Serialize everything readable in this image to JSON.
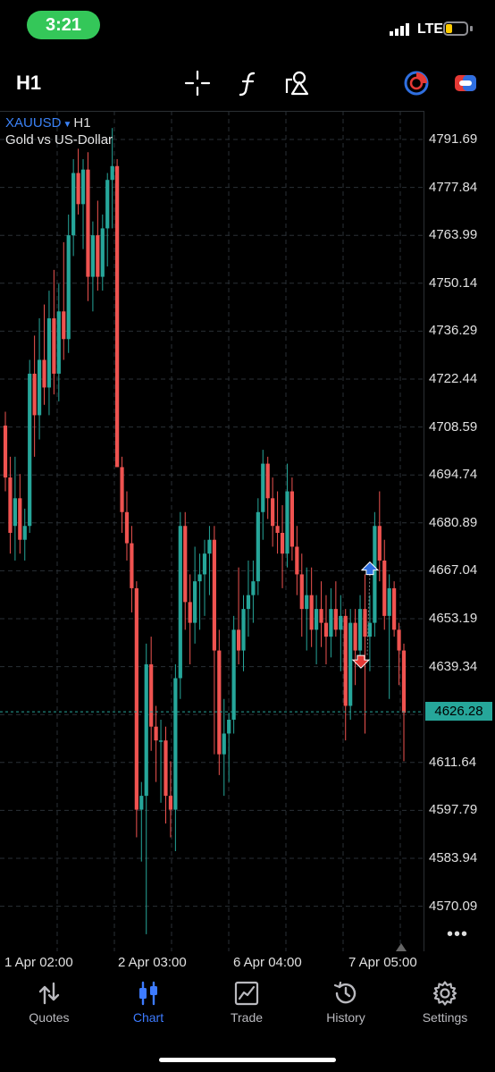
{
  "status_bar": {
    "time": "3:21",
    "network": "LTE",
    "battery_level": 0.3
  },
  "toolbar": {
    "timeframe": "H1",
    "icons": [
      "crosshair-icon",
      "function-icon",
      "objects-icon",
      "timeframe-clock-icon",
      "switch-icon"
    ]
  },
  "chart": {
    "symbol": "XAUUSD",
    "timeframe": "H1",
    "description": "Gold vs US-Dollar",
    "current_price": "4626.28",
    "colors": {
      "bull": "#26a69a",
      "bear": "#ef5350",
      "grid": "#2a3036",
      "price_line": "#26a69a"
    },
    "y_labels": [
      "4791.69",
      "4777.84",
      "4763.99",
      "4750.14",
      "4736.29",
      "4722.44",
      "4708.59",
      "4694.74",
      "4680.89",
      "4667.04",
      "4653.19",
      "4639.34",
      "4611.64",
      "4597.79",
      "4583.94",
      "4570.09"
    ],
    "x_labels": [
      "1 Apr 02:00",
      "2 Apr 03:00",
      "6 Apr 04:00",
      "7 Apr 05:00"
    ]
  },
  "chart_data": {
    "type": "candlestick",
    "ylim": [
      4562.0,
      4799.0
    ],
    "x_labels": [
      "1 Apr 02:00",
      "2 Apr 03:00",
      "6 Apr 04:00",
      "7 Apr 05:00"
    ],
    "candles": [
      [
        4709.0,
        4713.0,
        4690.0,
        4694.0
      ],
      [
        4694.0,
        4700.0,
        4672.0,
        4678.0
      ],
      [
        4680.0,
        4700.0,
        4670.0,
        4688.0
      ],
      [
        4688.0,
        4695.0,
        4672.0,
        4676.0
      ],
      [
        4676.0,
        4685.0,
        4670.0,
        4680.0
      ],
      [
        4680.0,
        4728.0,
        4678.0,
        4724.0
      ],
      [
        4724.0,
        4735.0,
        4700.0,
        4712.0
      ],
      [
        4712.0,
        4740.0,
        4705.0,
        4728.0
      ],
      [
        4728.0,
        4744.0,
        4715.0,
        4720.0
      ],
      [
        4720.0,
        4748.0,
        4712.0,
        4740.0
      ],
      [
        4740.0,
        4754.0,
        4718.0,
        4724.0
      ],
      [
        4724.0,
        4750.0,
        4716.0,
        4742.0
      ],
      [
        4742.0,
        4762.0,
        4728.0,
        4734.0
      ],
      [
        4734.0,
        4770.0,
        4730.0,
        4764.0
      ],
      [
        4764.0,
        4786.0,
        4758.0,
        4782.0
      ],
      [
        4782.0,
        4789.0,
        4770.0,
        4773.0
      ],
      [
        4773.0,
        4786.0,
        4760.0,
        4783.0
      ],
      [
        4783.0,
        4788.0,
        4745.0,
        4752.0
      ],
      [
        4752.0,
        4768.0,
        4742.0,
        4764.0
      ],
      [
        4764.0,
        4774.0,
        4748.0,
        4752.0
      ],
      [
        4752.0,
        4770.0,
        4748.0,
        4766.0
      ],
      [
        4766.0,
        4782.0,
        4755.0,
        4780.0
      ],
      [
        4780.0,
        4795.0,
        4766.0,
        4784.0
      ],
      [
        4784.0,
        4786.0,
        4697.0,
        4697.0
      ],
      [
        4697.0,
        4700.0,
        4678.0,
        4684.0
      ],
      [
        4684.0,
        4690.0,
        4670.0,
        4675.0
      ],
      [
        4675.0,
        4680.0,
        4655.0,
        4662.0
      ],
      [
        4662.0,
        4664.0,
        4590.0,
        4598.0
      ],
      [
        4598.0,
        4606.0,
        4583.0,
        4602.0
      ],
      [
        4602.0,
        4646.0,
        4562.0,
        4640.0
      ],
      [
        4640.0,
        4648.0,
        4615.0,
        4622.0
      ],
      [
        4622.0,
        4628.0,
        4606.0,
        4618.0
      ],
      [
        4618.0,
        4624.0,
        4600.0,
        4618.0
      ],
      [
        4618.0,
        4622.0,
        4594.0,
        4602.0
      ],
      [
        4602.0,
        4612.0,
        4590.0,
        4598.0
      ],
      [
        4598.0,
        4640.0,
        4586.0,
        4636.0
      ],
      [
        4636.0,
        4684.0,
        4630.0,
        4680.0
      ],
      [
        4680.0,
        4684.0,
        4650.0,
        4658.0
      ],
      [
        4658.0,
        4666.0,
        4640.0,
        4652.0
      ],
      [
        4652.0,
        4674.0,
        4646.0,
        4664.0
      ],
      [
        4664.0,
        4672.0,
        4650.0,
        4666.0
      ],
      [
        4666.0,
        4676.0,
        4654.0,
        4672.0
      ],
      [
        4672.0,
        4680.0,
        4660.0,
        4676.0
      ],
      [
        4676.0,
        4680.0,
        4614.0,
        4644.0
      ],
      [
        4644.0,
        4650.0,
        4608.0,
        4614.0
      ],
      [
        4614.0,
        4630.0,
        4602.0,
        4620.0
      ],
      [
        4620.0,
        4626.0,
        4606.0,
        4624.0
      ],
      [
        4624.0,
        4654.0,
        4620.0,
        4650.0
      ],
      [
        4650.0,
        4668.0,
        4640.0,
        4644.0
      ],
      [
        4644.0,
        4660.0,
        4638.0,
        4656.0
      ],
      [
        4656.0,
        4670.0,
        4648.0,
        4660.0
      ],
      [
        4660.0,
        4670.0,
        4652.0,
        4664.0
      ],
      [
        4664.0,
        4688.0,
        4660.0,
        4684.0
      ],
      [
        4684.0,
        4702.0,
        4676.0,
        4698.0
      ],
      [
        4698.0,
        4700.0,
        4682.0,
        4688.0
      ],
      [
        4688.0,
        4694.0,
        4674.0,
        4680.0
      ],
      [
        4680.0,
        4690.0,
        4672.0,
        4678.0
      ],
      [
        4678.0,
        4686.0,
        4662.0,
        4672.0
      ],
      [
        4672.0,
        4698.0,
        4668.0,
        4690.0
      ],
      [
        4690.0,
        4694.0,
        4670.0,
        4674.0
      ],
      [
        4674.0,
        4680.0,
        4660.0,
        4666.0
      ],
      [
        4666.0,
        4672.0,
        4648.0,
        4656.0
      ],
      [
        4656.0,
        4668.0,
        4644.0,
        4660.0
      ],
      [
        4660.0,
        4668.0,
        4645.0,
        4650.0
      ],
      [
        4650.0,
        4660.0,
        4640.0,
        4656.0
      ],
      [
        4656.0,
        4664.0,
        4645.0,
        4652.0
      ],
      [
        4652.0,
        4660.0,
        4640.0,
        4648.0
      ],
      [
        4648.0,
        4662.0,
        4642.0,
        4656.0
      ],
      [
        4656.0,
        4664.0,
        4648.0,
        4650.0
      ],
      [
        4650.0,
        4660.0,
        4638.0,
        4654.0
      ],
      [
        4654.0,
        4656.0,
        4618.0,
        4628.0
      ],
      [
        4628.0,
        4656.0,
        4624.0,
        4652.0
      ],
      [
        4652.0,
        4656.0,
        4634.0,
        4644.0
      ],
      [
        4644.0,
        4660.0,
        4640.0,
        4656.0
      ],
      [
        4656.0,
        4666.0,
        4620.0,
        4648.0
      ],
      [
        4648.0,
        4660.0,
        4638.0,
        4652.0
      ],
      [
        4652.0,
        4684.0,
        4648.0,
        4680.0
      ],
      [
        4680.0,
        4690.0,
        4664.0,
        4670.0
      ],
      [
        4670.0,
        4676.0,
        4650.0,
        4654.0
      ],
      [
        4654.0,
        4666.0,
        4630.0,
        4662.0
      ],
      [
        4662.0,
        4664.0,
        4648.0,
        4650.0
      ],
      [
        4650.0,
        4652.0,
        4634.0,
        4644.0
      ],
      [
        4644.0,
        4646.0,
        4612.0,
        4626.0
      ]
    ],
    "trade_markers": [
      {
        "type": "buy",
        "color": "#2f6fe0"
      },
      {
        "type": "sell",
        "color": "#e53935"
      }
    ]
  },
  "nav": {
    "items": [
      {
        "label": "Quotes",
        "icon": "quotes-icon"
      },
      {
        "label": "Chart",
        "icon": "chart-icon"
      },
      {
        "label": "Trade",
        "icon": "trade-icon"
      },
      {
        "label": "History",
        "icon": "history-icon"
      },
      {
        "label": "Settings",
        "icon": "settings-icon"
      }
    ],
    "active": "Chart",
    "active_color": "#3d7bff"
  }
}
